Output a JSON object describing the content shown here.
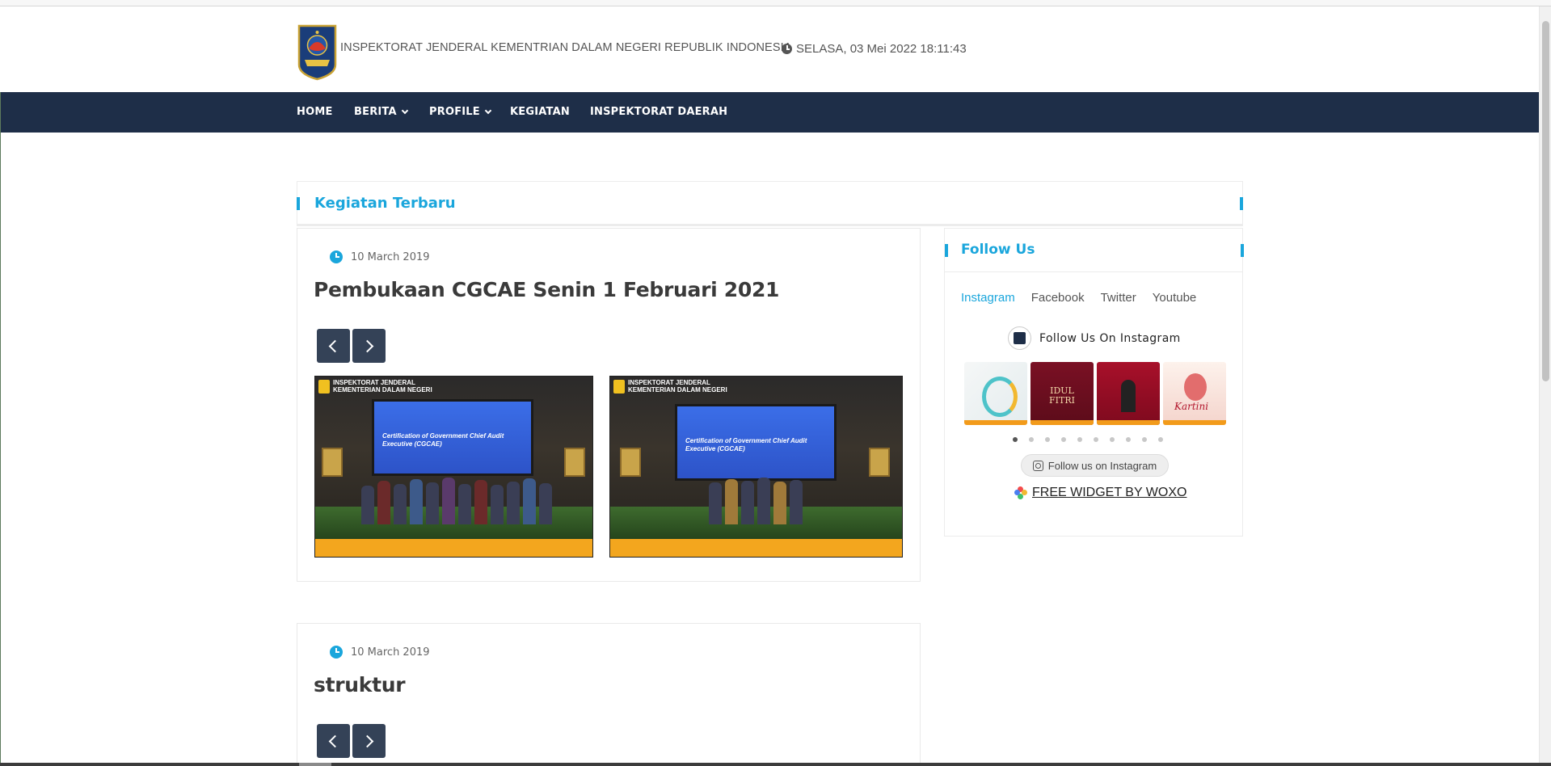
{
  "header": {
    "site_title": "INSPEKTORAT JENDERAL KEMENTRIAN DALAM NEGERI REPUBLIK INDONESIA",
    "datetime": "SELASA, 03 Mei 2022 18:11:43",
    "icon": "clock-icon"
  },
  "nav": {
    "items": [
      {
        "label": "HOME",
        "has_dropdown": false
      },
      {
        "label": "BERITA",
        "has_dropdown": true
      },
      {
        "label": "PROFILE",
        "has_dropdown": true
      },
      {
        "label": "KEGIATAN",
        "has_dropdown": false
      },
      {
        "label": "INSPEKTORAT DAERAH",
        "has_dropdown": false
      }
    ],
    "background": "#1e2e48"
  },
  "main": {
    "section_title": "Kegiatan Terbaru",
    "posts": [
      {
        "date": "10 March 2019",
        "title": "Pembukaan CGCAE Senin 1 Februari 2021",
        "photos": [
          {
            "brand_line1": "INSPEKTORAT JENDERAL",
            "brand_line2": "KEMENTERIAN DALAM NEGERI",
            "screen_text": "Certification of Government Chief Audit Executive (CGCAE)"
          },
          {
            "brand_line1": "INSPEKTORAT JENDERAL",
            "brand_line2": "KEMENTERIAN DALAM NEGERI",
            "screen_text": "Certification of Government Chief Audit Executive (CGCAE)"
          }
        ]
      },
      {
        "date": "10 March 2019",
        "title": "struktur"
      }
    ]
  },
  "sidebar": {
    "follow_title": "Follow Us",
    "tabs": [
      {
        "label": "Instagram",
        "active": true
      },
      {
        "label": "Facebook",
        "active": false
      },
      {
        "label": "Twitter",
        "active": false
      },
      {
        "label": "Youtube",
        "active": false
      }
    ],
    "instagram_heading": "Follow Us On Instagram",
    "thumb_text": {
      "idul": "IDUL FITRI",
      "kartini": "Kartini"
    },
    "carousel_pages": 10,
    "carousel_active": 1,
    "follow_button": "Follow us on Instagram",
    "widget_credit": "FREE WIDGET BY WOXO"
  },
  "colors": {
    "accent": "#1aa6dc",
    "nav_bg": "#1e2e48",
    "arrow_btn": "#344257"
  }
}
